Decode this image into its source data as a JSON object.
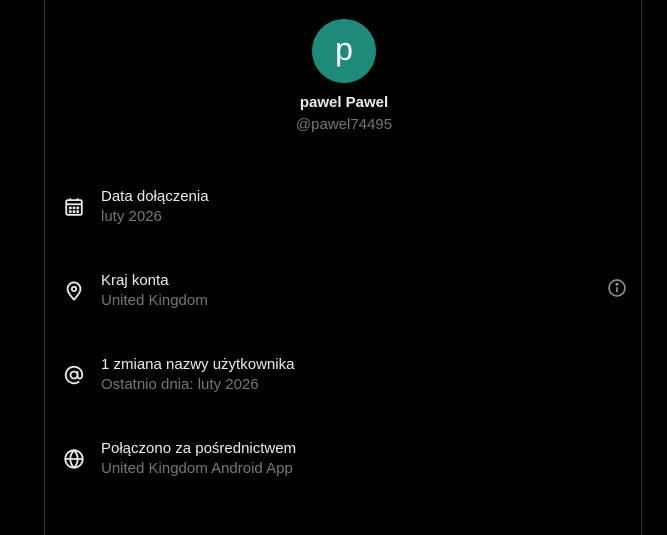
{
  "profile": {
    "avatar_letter": "p",
    "avatar_color": "#1e8a7a",
    "display_name": "pawel Pawel",
    "handle": "@pawel74495"
  },
  "details": [
    {
      "icon": "calendar-icon",
      "title": "Data dołączenia",
      "value": "luty 2026"
    },
    {
      "icon": "location-pin-icon",
      "title": "Kraj konta",
      "value": "United Kingdom",
      "info_icon": "info-icon"
    },
    {
      "icon": "at-sign-icon",
      "title": "1 zmiana nazwy użytkownika",
      "value": "Ostatnio dnia: luty 2026"
    },
    {
      "icon": "globe-icon",
      "title": "Połączono za pośrednictwem",
      "value": "United Kingdom Android App"
    }
  ],
  "colors": {
    "background": "#000000",
    "primary_text": "#e7e9ea",
    "secondary_text": "#71767b",
    "border": "#2f3336"
  }
}
